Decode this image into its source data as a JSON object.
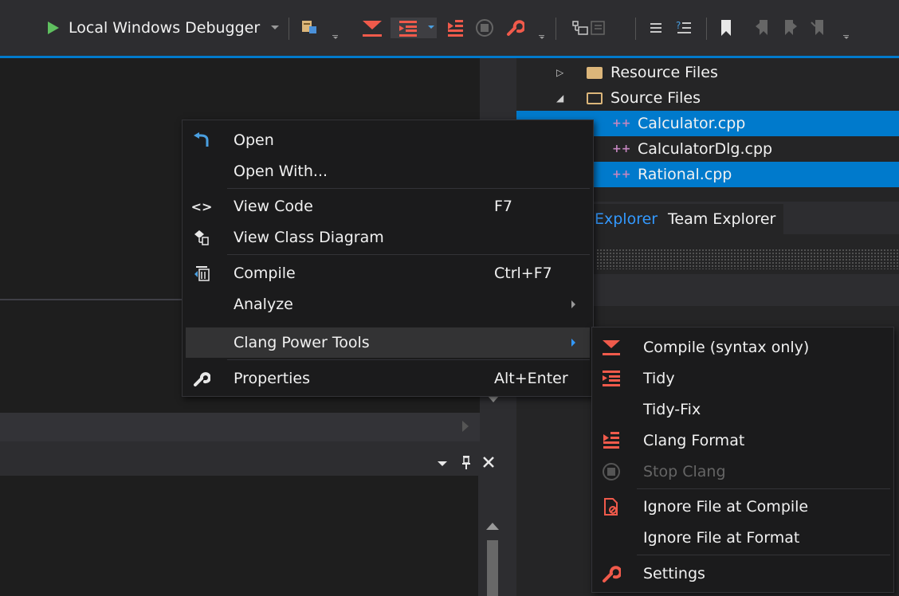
{
  "toolbar": {
    "debugger_label": "Local Windows Debugger"
  },
  "solution_explorer": {
    "items": [
      {
        "label": "Resource Files",
        "type": "folder"
      },
      {
        "label": "Source Files",
        "type": "folder"
      },
      {
        "label": "Calculator.cpp",
        "type": "cpp"
      },
      {
        "label": "CalculatorDlg.cpp",
        "type": "cpp"
      },
      {
        "label": "Rational.cpp",
        "type": "cpp"
      }
    ],
    "tabs": [
      "Explorer",
      "Team Explorer"
    ]
  },
  "context_menu": {
    "items": [
      {
        "label": "Open",
        "icon": "undo-arrow-icon"
      },
      {
        "label": "Open With..."
      },
      {
        "label": "View Code",
        "shortcut": "F7",
        "icon": "code-brackets-icon"
      },
      {
        "label": "View Class Diagram",
        "icon": "class-diagram-icon"
      },
      {
        "label": "Compile",
        "shortcut": "Ctrl+F7",
        "icon": "compile-icon"
      },
      {
        "label": "Analyze"
      },
      {
        "label": "Clang Power Tools"
      },
      {
        "label": "Properties",
        "shortcut": "Alt+Enter",
        "icon": "wrench-icon"
      }
    ]
  },
  "submenu": {
    "items": [
      {
        "label": "Compile (syntax only)",
        "icon": "compile-syntax-icon"
      },
      {
        "label": "Tidy",
        "icon": "tidy-icon"
      },
      {
        "label": "Tidy-Fix"
      },
      {
        "label": "Clang Format",
        "icon": "clang-format-icon"
      },
      {
        "label": "Stop Clang",
        "icon": "stop-icon",
        "disabled": true
      },
      {
        "label": "Ignore File at Compile",
        "icon": "ignore-file-icon"
      },
      {
        "label": "Ignore File at Format"
      },
      {
        "label": "Settings",
        "icon": "wrench-icon"
      }
    ]
  },
  "colors": {
    "accent": "#007acc",
    "clang_red": "#f05a4b",
    "play_green": "#5fbf5f"
  }
}
